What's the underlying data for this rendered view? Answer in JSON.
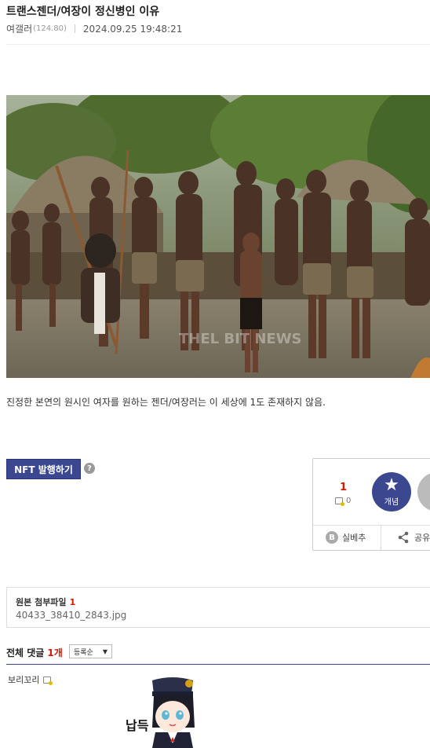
{
  "post": {
    "title": "트랜스젠더/여장이 정신병인 이유",
    "author": "여갤러",
    "ip": "(124.80)",
    "datetime": "2024.09.25 19:48:21",
    "body": "진정한 본연의 원시인 여자를 원하는 젠더/여장러는 이 세상에 1도 존재하지 않음."
  },
  "image": {
    "watermark": "THEL BIT NEWS"
  },
  "actions": {
    "nft_label": "NFT 발행하기",
    "help_glyph": "?"
  },
  "vote": {
    "up_count": "1",
    "fix_count": "0",
    "up_label": "개념",
    "silbe_label": "실베추",
    "silbe_glyph": "B",
    "share_label": "공유"
  },
  "attachments": {
    "title": "원본 첨부파일",
    "count": "1",
    "files": [
      "40433_38410_2843.jpg"
    ]
  },
  "comments": {
    "title": "전체 댓글",
    "count": "1개",
    "sort_selected": "등록순",
    "items": [
      {
        "author": "보리꼬리",
        "dccon_text": "납득"
      }
    ]
  },
  "colors": {
    "accent": "#3b4890",
    "count_red": "#d31900"
  }
}
